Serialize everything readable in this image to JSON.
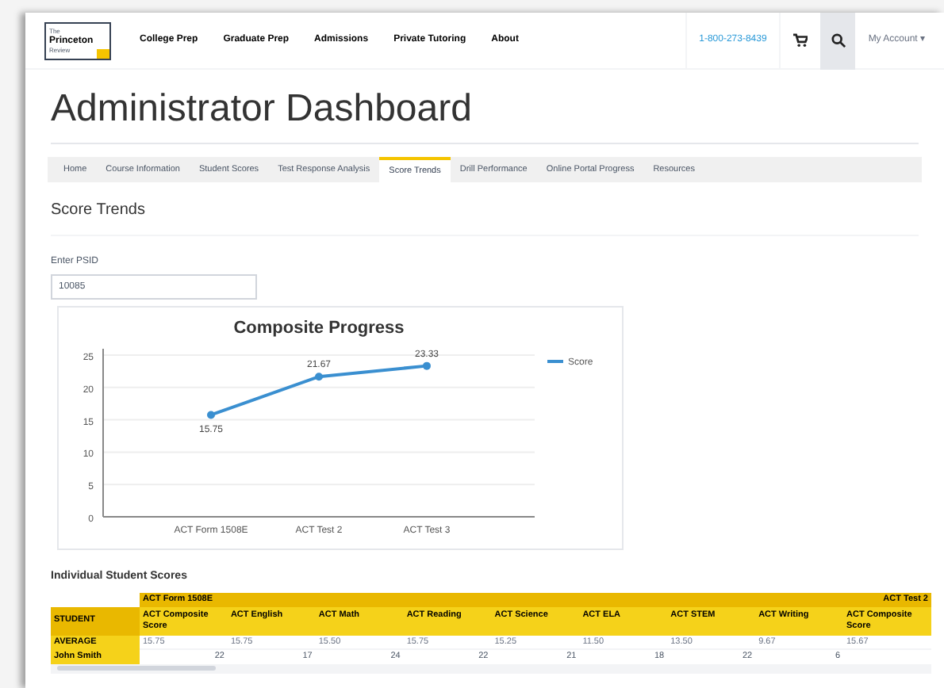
{
  "nav": {
    "logo": [
      "The",
      "Princeton",
      "Review"
    ],
    "links": [
      "College Prep",
      "Graduate Prep",
      "Admissions",
      "Private Tutoring",
      "About"
    ],
    "phone": "1-800-273-8439",
    "account": "My Account ▾"
  },
  "title": "Administrator Dashboard",
  "tabs": [
    {
      "label": "Home",
      "selected": false
    },
    {
      "label": "Course Information",
      "selected": false
    },
    {
      "label": "Student Scores",
      "selected": false
    },
    {
      "label": "Test Response Analysis",
      "selected": false
    },
    {
      "label": "Score Trends",
      "selected": true
    },
    {
      "label": "Drill Performance",
      "selected": false
    },
    {
      "label": "Online Portal Progress",
      "selected": false
    },
    {
      "label": "Resources",
      "selected": false
    }
  ],
  "section_title": "Score Trends",
  "psid": {
    "label": "Enter PSID",
    "value": "10085"
  },
  "chart": {
    "chart_data": {
      "type": "line",
      "title": "Composite Progress",
      "categories": [
        "ACT Form 1508E",
        "ACT Test 2",
        "ACT Test 3"
      ],
      "series": [
        {
          "name": "Score",
          "color": "#3a8fd0",
          "marker": true,
          "values": [
            15.75,
            21.67,
            23.33
          ]
        }
      ],
      "grid": true,
      "ylim": [
        0,
        25
      ],
      "yticks": [
        0,
        5,
        10,
        15,
        20,
        25
      ],
      "value_labels": [
        "15.75",
        "21.67",
        "23.33"
      ]
    }
  },
  "table": {
    "title": "Individual Student Scores",
    "groups": [
      {
        "label": "ACT Form 1508E"
      },
      {
        "label": "ACT Test 2"
      }
    ],
    "student_header": "STUDENT",
    "columns": [
      "ACT Composite Score",
      "ACT English",
      "ACT Math",
      "ACT Reading",
      "ACT Science",
      "ACT ELA",
      "ACT STEM",
      "ACT Writing",
      "ACT Composite Score"
    ],
    "rows": [
      {
        "student": "AVERAGE",
        "cells": [
          "15.75",
          "15.75",
          "15.50",
          "15.75",
          "15.25",
          "11.50",
          "13.50",
          "9.67",
          "15.67"
        ]
      },
      {
        "student": "John Smith",
        "cells": [
          "22",
          "17",
          "24",
          "22",
          "21",
          "18",
          "22",
          "6"
        ]
      }
    ]
  }
}
